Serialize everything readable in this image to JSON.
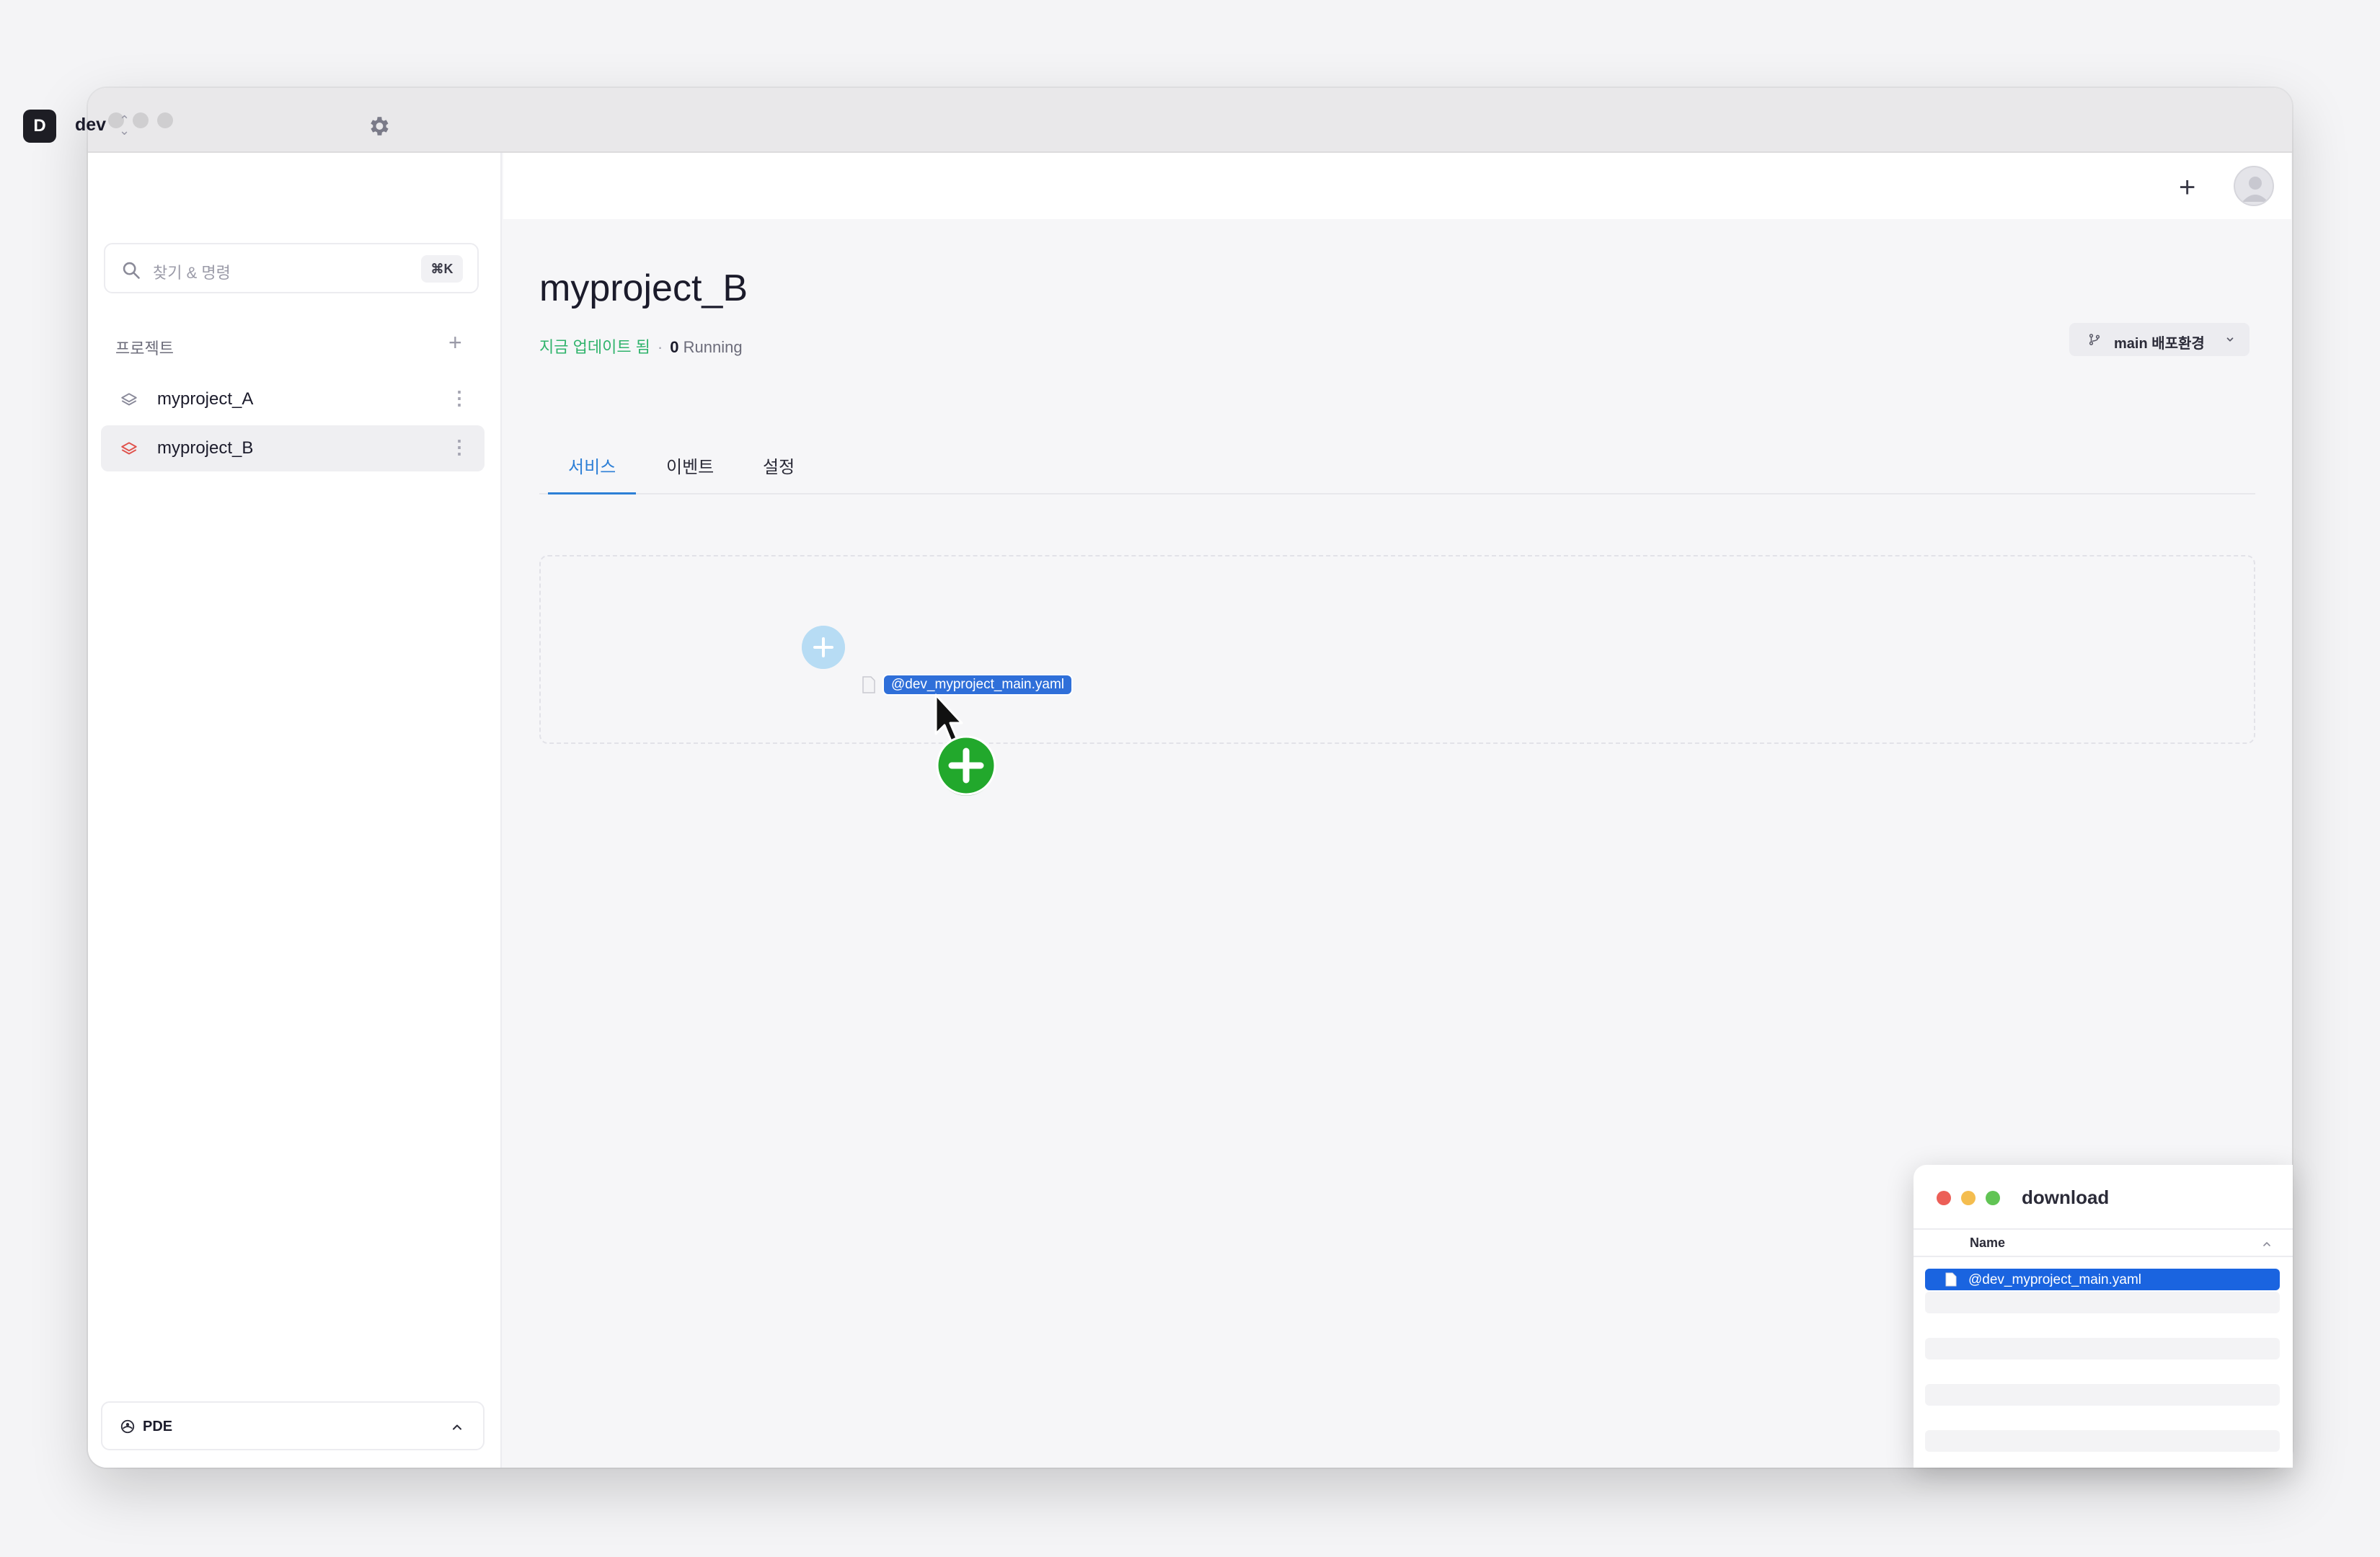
{
  "workspace": {
    "avatar_letter": "D",
    "name": "dev"
  },
  "search": {
    "placeholder": "찾기 & 명령",
    "shortcut": "⌘K"
  },
  "projects": {
    "section_label": "프로젝트",
    "items": [
      {
        "name": "myproject_A",
        "icon_color": "#8a8a9a",
        "active": false
      },
      {
        "name": "myproject_B",
        "icon_color": "#e0524c",
        "active": true
      }
    ]
  },
  "footer": {
    "label": "PDE"
  },
  "page": {
    "title": "myproject_B",
    "updated_text": "지금 업데이트 됨",
    "separator": "·",
    "running_count": "0",
    "running_label": "Running",
    "environment_label": "main 배포환경"
  },
  "tabs": [
    {
      "label": "서비스",
      "active": true
    },
    {
      "label": "이벤트",
      "active": false
    },
    {
      "label": "설정",
      "active": false
    }
  ],
  "drag": {
    "file_name": "@dev_myproject_main.yaml"
  },
  "finder": {
    "title": "download",
    "column_name": "Name",
    "files": [
      {
        "name": "@dev_myproject_main.yaml",
        "selected": true
      }
    ]
  },
  "colors": {
    "accent": "#2d7fd6",
    "updated_green": "#2fb36b",
    "finder_selection": "#1a64e0",
    "copy_badge_green": "#22a82c"
  }
}
